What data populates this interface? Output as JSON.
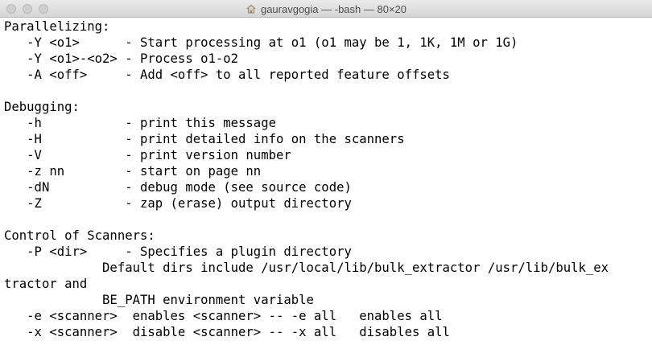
{
  "window": {
    "title": "gauravgogia — -bash — 80×20",
    "home_icon": "house-icon"
  },
  "terminal": {
    "lines": [
      "Parallelizing:",
      "   -Y <o1>      - Start processing at o1 (o1 may be 1, 1K, 1M or 1G)",
      "   -Y <o1>-<o2> - Process o1-o2",
      "   -A <off>     - Add <off> to all reported feature offsets",
      "",
      "Debugging:",
      "   -h           - print this message",
      "   -H           - print detailed info on the scanners",
      "   -V           - print version number",
      "   -z nn        - start on page nn",
      "   -dN          - debug mode (see source code)",
      "   -Z           - zap (erase) output directory",
      "",
      "Control of Scanners:",
      "   -P <dir>     - Specifies a plugin directory",
      "             Default dirs include /usr/local/lib/bulk_extractor /usr/lib/bulk_ex",
      "tractor and",
      "             BE_PATH environment variable",
      "   -e <scanner>  enables <scanner> -- -e all   enables all",
      "   -x <scanner>  disable <scanner> -- -x all   disables all"
    ]
  }
}
